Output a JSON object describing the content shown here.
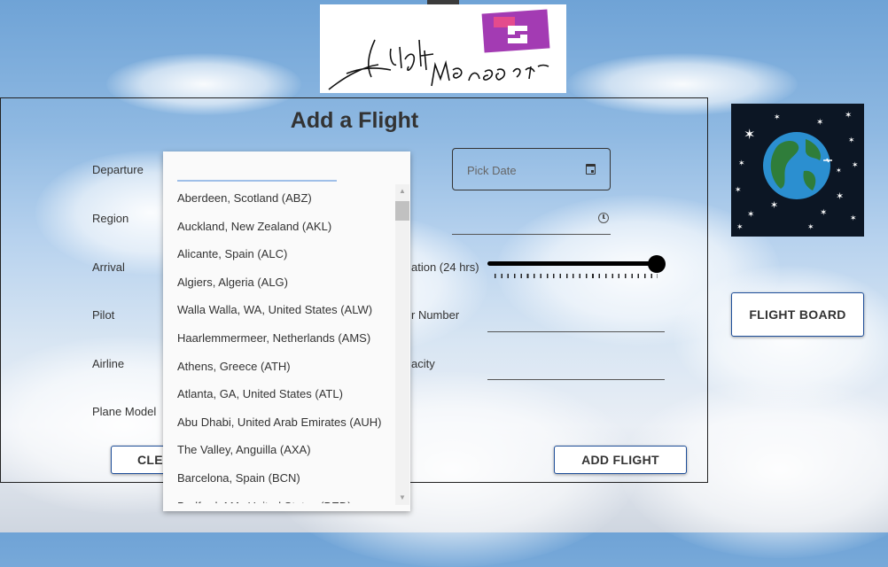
{
  "page": {
    "title": "Add a Flight"
  },
  "form": {
    "labels": {
      "departure": "Departure",
      "region": "Region",
      "arrival": "Arrival",
      "pilot": "Pilot",
      "airline": "Airline",
      "plane_model": "Plane Model",
      "duration_partial": "ation (24 hrs)",
      "flight_number_partial": "r Number",
      "capacity_partial": "acity"
    },
    "date_placeholder": "Pick Date",
    "duration_slider": {
      "value_fraction": 1.0
    },
    "clear_button_partial": "CLEA",
    "add_flight_button": "ADD FLIGHT"
  },
  "sidebar": {
    "flight_board_button": "FLIGHT BOARD"
  },
  "dropdown": {
    "search_value": "",
    "options": [
      "Aberdeen, Scotland (ABZ)",
      "Auckland, New Zealand (AKL)",
      "Alicante, Spain (ALC)",
      "Algiers, Algeria (ALG)",
      "Walla Walla, WA, United States (ALW)",
      "Haarlemmermeer, Netherlands (AMS)",
      "Athens, Greece (ATH)",
      "Atlanta, GA, United States (ATL)",
      "Abu Dhabi, United Arab Emirates (AUH)",
      "The Valley, Anguilla (AXA)",
      "Barcelona, Spain (BCN)",
      "Bedford, MA, United States (BED)"
    ]
  },
  "icons": {
    "calendar": "calendar-icon",
    "clock": "clock-icon",
    "scroll_up": "▲",
    "scroll_down": "▼"
  },
  "colors": {
    "button_border": "#1f4f9a",
    "logo_accent": "#a33bb3",
    "earth_background": "#0c1624"
  }
}
